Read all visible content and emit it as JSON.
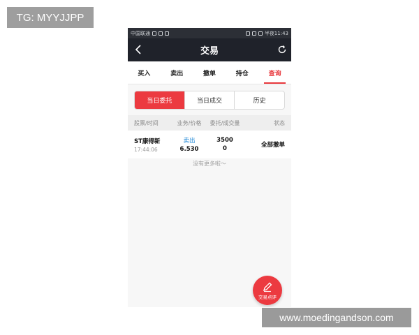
{
  "watermarks": {
    "top_left": "TG: MYYJJPP",
    "bottom_right": "www.moedingandson.com"
  },
  "statusbar": {
    "carrier": "中国联通",
    "time": "半夜11:43"
  },
  "navbar": {
    "title": "交易",
    "back_icon": "back-arrow-icon",
    "refresh_icon": "refresh-icon"
  },
  "tabs": [
    {
      "label": "买入"
    },
    {
      "label": "卖出"
    },
    {
      "label": "撤单"
    },
    {
      "label": "持仓"
    },
    {
      "label": "查询",
      "active": true
    }
  ],
  "segments": [
    {
      "label": "当日委托",
      "active": true
    },
    {
      "label": "当日成交"
    },
    {
      "label": "历史"
    }
  ],
  "table": {
    "headers": [
      "股票/时间",
      "业务/价格",
      "委托/成交量",
      "状态"
    ],
    "rows": [
      {
        "name": "ST康得新",
        "time": "17:44:06",
        "biz": "卖出",
        "price": "6.530",
        "qty": "3500",
        "filled": "0",
        "status": "全部撤单"
      }
    ]
  },
  "no_more": "没有更多啦～",
  "fab": {
    "label": "交易点评",
    "icon": "pencil-icon"
  },
  "colors": {
    "accent": "#ec3a40",
    "nav_bg": "#1f222a",
    "link_blue": "#1f87d6"
  }
}
